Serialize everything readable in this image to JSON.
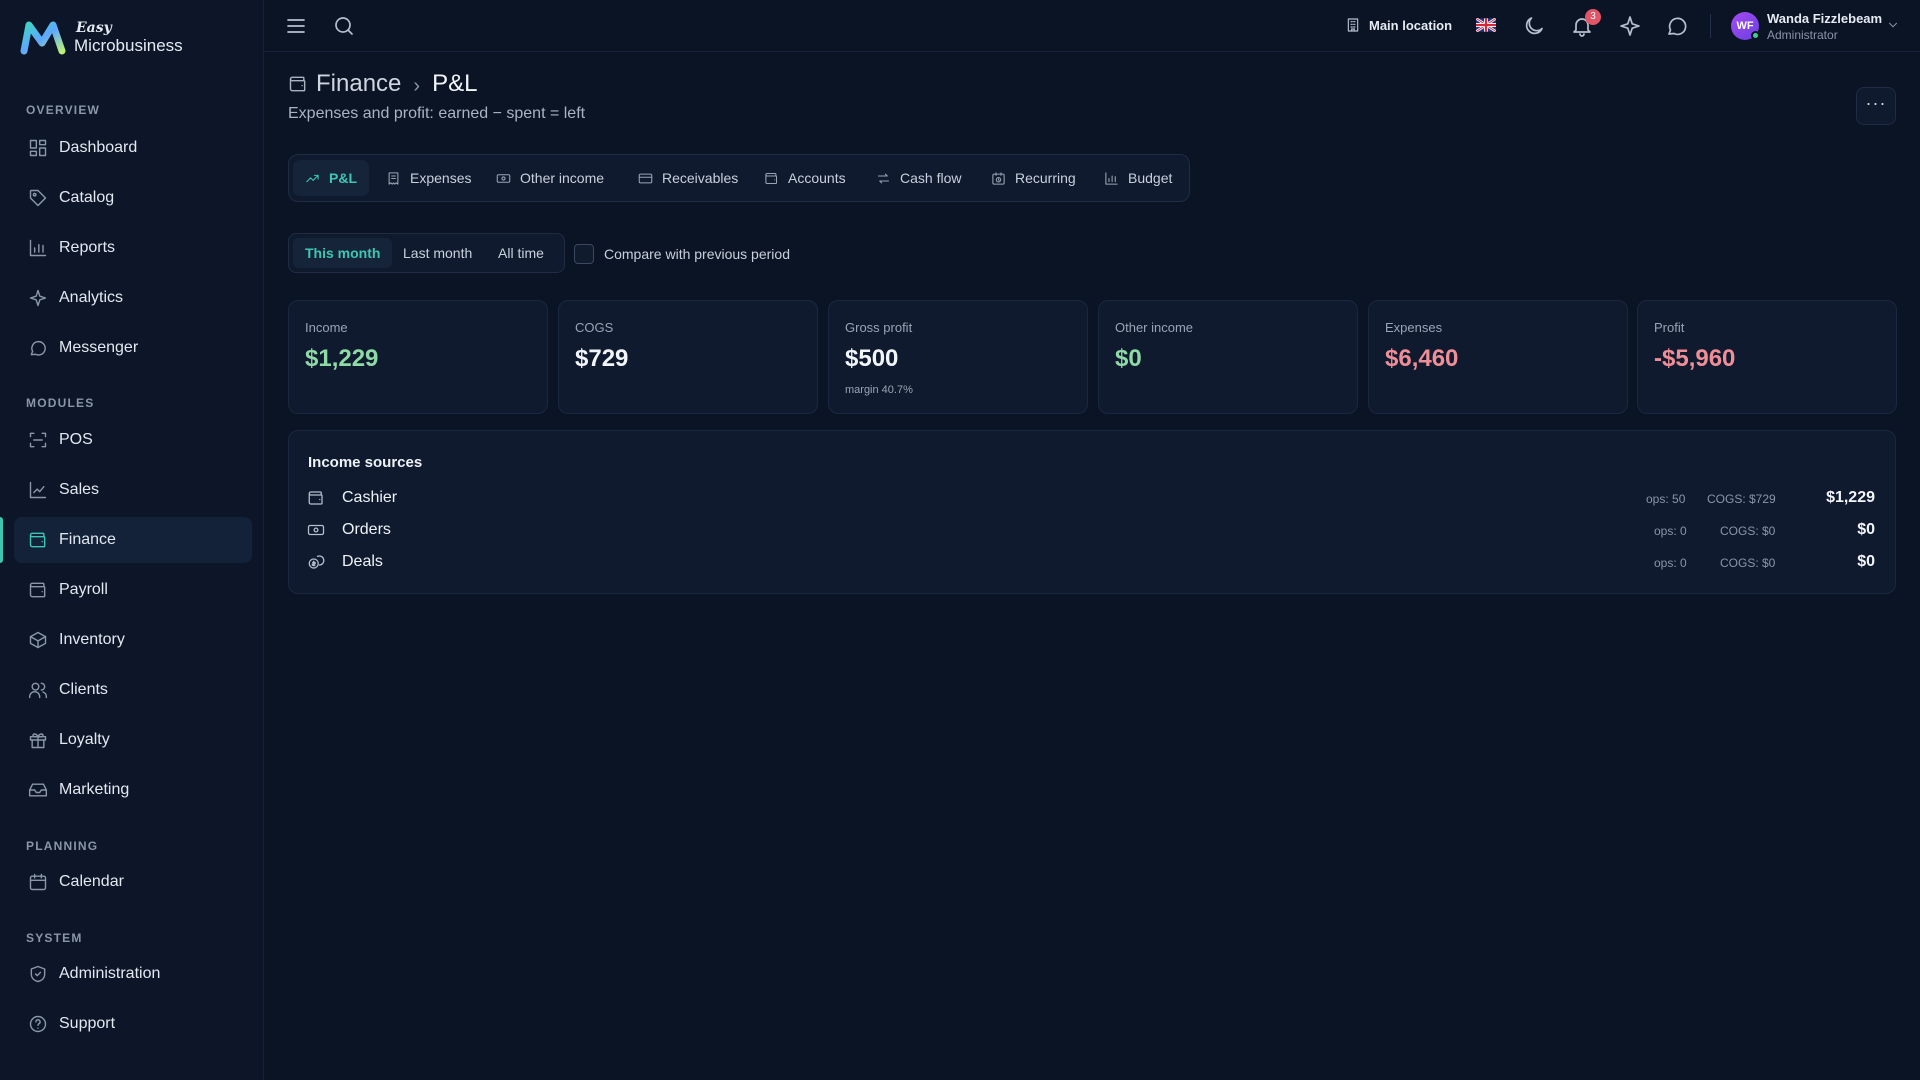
{
  "brand": {
    "easy": "Easy",
    "name": "Microbusiness",
    "accent": "#3ec7b0"
  },
  "sidebar": {
    "sections": [
      {
        "label": "OVERVIEW"
      },
      {
        "label": "MODULES"
      },
      {
        "label": "PLANNING"
      },
      {
        "label": "SYSTEM"
      }
    ],
    "items": [
      {
        "label": "Dashboard",
        "icon": "grid-icon"
      },
      {
        "label": "Catalog",
        "icon": "tag-icon"
      },
      {
        "label": "Reports",
        "icon": "bar-chart-icon"
      },
      {
        "label": "Analytics",
        "icon": "sparkle-icon"
      },
      {
        "label": "Messenger",
        "icon": "chat-icon"
      },
      {
        "label": "POS",
        "icon": "scan-icon"
      },
      {
        "label": "Sales",
        "icon": "line-chart-icon"
      },
      {
        "label": "Finance",
        "icon": "wallet-icon",
        "active": true
      },
      {
        "label": "Payroll",
        "icon": "wallet-icon"
      },
      {
        "label": "Inventory",
        "icon": "box-icon"
      },
      {
        "label": "Clients",
        "icon": "users-icon"
      },
      {
        "label": "Loyalty",
        "icon": "gift-icon"
      },
      {
        "label": "Marketing",
        "icon": "inbox-icon"
      },
      {
        "label": "Calendar",
        "icon": "calendar-icon"
      },
      {
        "label": "Administration",
        "icon": "shield-icon"
      },
      {
        "label": "Support",
        "icon": "help-icon"
      }
    ]
  },
  "topbar": {
    "location": "Main location",
    "notifications_count": "3",
    "user": {
      "initials": "WF",
      "name": "Wanda Fizzlebeam",
      "role": "Administrator"
    }
  },
  "header": {
    "parent": "Finance",
    "separator": "›",
    "current": "P&L",
    "subtitle": "Expenses and profit: earned − spent = left",
    "more": "···"
  },
  "tabs": [
    {
      "label": "P&L",
      "icon": "trend-icon",
      "active": true
    },
    {
      "label": "Expenses",
      "icon": "receipt-icon"
    },
    {
      "label": "Other income",
      "icon": "cash-icon"
    },
    {
      "label": "Receivables",
      "icon": "card-icon"
    },
    {
      "label": "Accounts",
      "icon": "wallet-icon"
    },
    {
      "label": "Cash flow",
      "icon": "transfer-icon"
    },
    {
      "label": "Recurring",
      "icon": "calendar-clock-icon"
    },
    {
      "label": "Budget",
      "icon": "bar-chart-icon"
    }
  ],
  "periods": [
    {
      "label": "This month",
      "active": true
    },
    {
      "label": "Last month"
    },
    {
      "label": "All time"
    }
  ],
  "compare_label": "Compare with previous period",
  "kpis": [
    {
      "label": "Income",
      "value": "$1,229",
      "tone": "green"
    },
    {
      "label": "COGS",
      "value": "$729",
      "tone": "white"
    },
    {
      "label": "Gross profit",
      "value": "$500",
      "tone": "white",
      "note": "margin 40.7%"
    },
    {
      "label": "Other income",
      "value": "$0",
      "tone": "green"
    },
    {
      "label": "Expenses",
      "value": "$6,460",
      "tone": "red"
    },
    {
      "label": "Profit",
      "value": "-$5,960",
      "tone": "red"
    }
  ],
  "income_sources": {
    "title": "Income sources",
    "rows": [
      {
        "name": "Cashier",
        "icon": "wallet-icon",
        "ops": "ops: 50",
        "cogs": "COGS: $729",
        "total": "$1,229"
      },
      {
        "name": "Orders",
        "icon": "cash-icon",
        "ops": "ops: 0",
        "cogs": "COGS: $0",
        "total": "$0"
      },
      {
        "name": "Deals",
        "icon": "coins-icon",
        "ops": "ops: 0",
        "cogs": "COGS: $0",
        "total": "$0"
      }
    ]
  }
}
